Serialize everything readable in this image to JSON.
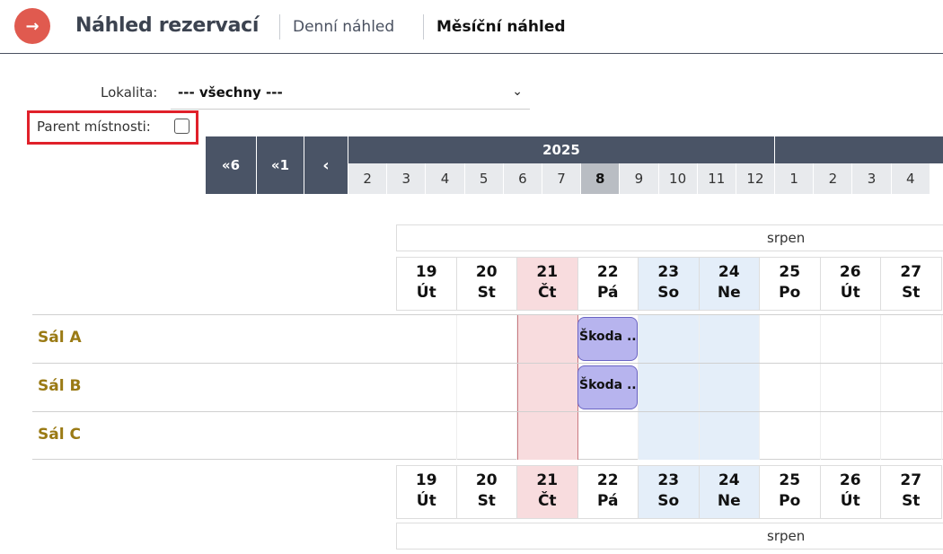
{
  "header": {
    "back_icon": "arrow-right-icon",
    "back_glyph": "→",
    "title": "Náhled rezervací",
    "tabs": [
      {
        "label": "Denní náhled",
        "active": false
      },
      {
        "label": "Měsíční náhled",
        "active": true
      }
    ]
  },
  "filters": {
    "lokalita_label": "Lokalita:",
    "lokalita_value": "--- všechny ---",
    "chevron_icon": "chevron-down-icon",
    "parent_label": "Parent místnosti:",
    "parent_checked": false
  },
  "navigation": {
    "prev6": "«6",
    "prev1": "«1",
    "prev": "‹",
    "year_current": "2025",
    "year_next": "",
    "months": [
      "2",
      "3",
      "4",
      "5",
      "6",
      "7",
      "8",
      "9",
      "10",
      "11",
      "12",
      "1",
      "2",
      "3",
      "4"
    ],
    "selected_month": "8"
  },
  "calendar": {
    "month_name": "srpen",
    "days": [
      {
        "num": "19",
        "dow": "Út",
        "type": "normal"
      },
      {
        "num": "20",
        "dow": "St",
        "type": "normal"
      },
      {
        "num": "21",
        "dow": "Čt",
        "type": "today"
      },
      {
        "num": "22",
        "dow": "Pá",
        "type": "normal"
      },
      {
        "num": "23",
        "dow": "So",
        "type": "weekend"
      },
      {
        "num": "24",
        "dow": "Ne",
        "type": "weekend"
      },
      {
        "num": "25",
        "dow": "Po",
        "type": "normal"
      },
      {
        "num": "26",
        "dow": "Út",
        "type": "normal"
      },
      {
        "num": "27",
        "dow": "St",
        "type": "normal"
      }
    ],
    "rooms": [
      {
        "name": "Sál A",
        "booking": "Škoda ..."
      },
      {
        "name": "Sál B",
        "booking": "Škoda ..."
      },
      {
        "name": "Sál C",
        "booking": ""
      }
    ],
    "colors": {
      "today": "#f8dcde",
      "weekend": "#e4eef9",
      "booking": "#b7b4ee",
      "room_label": "#9a7a14"
    }
  }
}
